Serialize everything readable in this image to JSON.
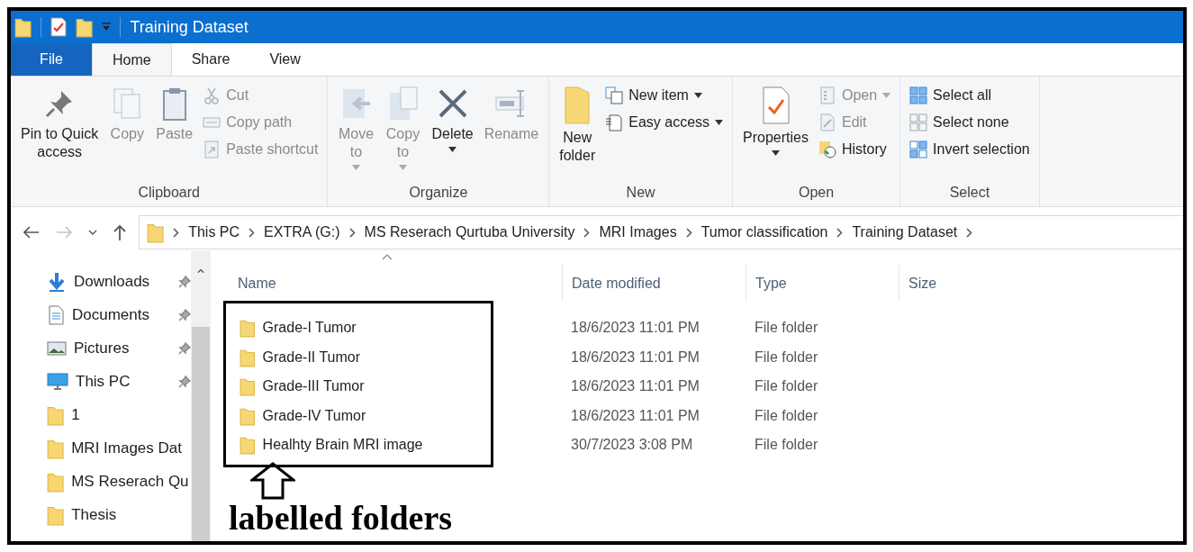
{
  "window": {
    "title": "Training Dataset"
  },
  "tabs": [
    {
      "label": "File",
      "kind": "menu",
      "selected": false
    },
    {
      "label": "Home",
      "kind": "tab",
      "selected": true
    },
    {
      "label": "Share",
      "kind": "tab",
      "selected": false
    },
    {
      "label": "View",
      "kind": "tab",
      "selected": false
    }
  ],
  "ribbon": {
    "groups": [
      {
        "label": "Clipboard",
        "large": [
          {
            "label": "Pin to Quick\naccess",
            "disabled": false,
            "dropdown": false
          },
          {
            "label": "Copy",
            "disabled": true,
            "dropdown": false
          },
          {
            "label": "Paste",
            "disabled": true,
            "dropdown": false
          }
        ],
        "small": [
          {
            "label": "Cut",
            "disabled": true,
            "dropdown": false
          },
          {
            "label": "Copy path",
            "disabled": true,
            "dropdown": false
          },
          {
            "label": "Paste shortcut",
            "disabled": true,
            "dropdown": false
          }
        ]
      },
      {
        "label": "Organize",
        "large": [
          {
            "label": "Move\nto",
            "disabled": true,
            "dropdown": true
          },
          {
            "label": "Copy\nto",
            "disabled": true,
            "dropdown": true
          },
          {
            "label": "Delete",
            "disabled": false,
            "dropdown": true
          },
          {
            "label": "Rename",
            "disabled": true,
            "dropdown": false
          }
        ]
      },
      {
        "label": "New",
        "large": [
          {
            "label": "New\nfolder",
            "disabled": false,
            "dropdown": false
          }
        ],
        "small": [
          {
            "label": "New item",
            "disabled": false,
            "dropdown": true
          },
          {
            "label": "Easy access",
            "disabled": false,
            "dropdown": true
          }
        ]
      },
      {
        "label": "Open",
        "large": [
          {
            "label": "Properties",
            "disabled": false,
            "dropdown": true
          }
        ],
        "small": [
          {
            "label": "Open",
            "disabled": true,
            "dropdown": true
          },
          {
            "label": "Edit",
            "disabled": true,
            "dropdown": false
          },
          {
            "label": "History",
            "disabled": false,
            "dropdown": false
          }
        ]
      },
      {
        "label": "Select",
        "small": [
          {
            "label": "Select all",
            "disabled": false,
            "dropdown": false
          },
          {
            "label": "Select none",
            "disabled": false,
            "dropdown": false
          },
          {
            "label": "Invert selection",
            "disabled": false,
            "dropdown": false
          }
        ]
      }
    ]
  },
  "nav": [
    {
      "kind": "back",
      "disabled": false
    },
    {
      "kind": "forward",
      "disabled": true
    },
    {
      "kind": "recent",
      "disabled": false
    },
    {
      "kind": "up",
      "disabled": false
    }
  ],
  "address": {
    "crumbs": [
      "This PC",
      "EXTRA (G:)",
      "MS Reserach Qurtuba University",
      "MRI Images",
      "Tumor classification",
      "Training Dataset"
    ]
  },
  "sidebar": {
    "items": [
      {
        "label": "Downloads",
        "kind": "downloads",
        "pinned": true
      },
      {
        "label": "Documents",
        "kind": "documents",
        "pinned": true
      },
      {
        "label": "Pictures",
        "kind": "pictures",
        "pinned": true
      },
      {
        "label": "This PC",
        "kind": "computer",
        "pinned": true
      },
      {
        "label": "1",
        "kind": "folder",
        "pinned": false
      },
      {
        "label": "MRI Images Dat",
        "kind": "folder",
        "pinned": false
      },
      {
        "label": "MS Reserach Qu",
        "kind": "folder",
        "pinned": false
      },
      {
        "label": "Thesis",
        "kind": "folder",
        "pinned": false
      }
    ]
  },
  "table": {
    "columns": [
      "Name",
      "Date modified",
      "Type",
      "Size"
    ],
    "rows": [
      {
        "name": "Grade-I Tumor",
        "date": "18/6/2023 11:01 PM",
        "type": "File folder"
      },
      {
        "name": "Grade-II Tumor",
        "date": "18/6/2023 11:01 PM",
        "type": "File folder"
      },
      {
        "name": "Grade-III Tumor",
        "date": "18/6/2023 11:01 PM",
        "type": "File folder"
      },
      {
        "name": "Grade-IV Tumor",
        "date": "18/6/2023 11:01 PM",
        "type": "File folder"
      },
      {
        "name": "Healhty Brain MRI image",
        "date": "30/7/2023 3:08 PM",
        "type": "File folder"
      }
    ]
  },
  "annotation": {
    "caption": "labelled folders"
  }
}
